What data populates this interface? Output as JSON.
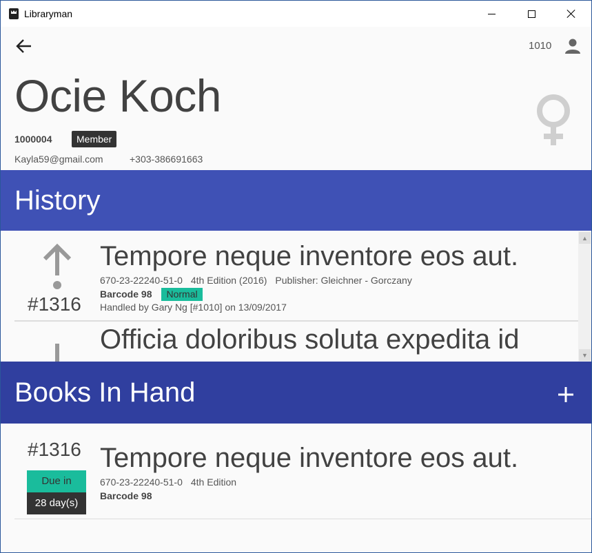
{
  "window": {
    "title": "Libraryman"
  },
  "appbar": {
    "user_id": "1010"
  },
  "member": {
    "name": "Ocie Koch",
    "id": "1000004",
    "badge": "Member",
    "email": "Kayla59@gmail.com",
    "phone": "+303-386691663",
    "gender_icon": "female-icon"
  },
  "history": {
    "title": "History",
    "items": [
      {
        "direction_icon": "arrow-up-icon",
        "number": "#1316",
        "book_title": "Tempore neque inventore eos aut.",
        "isbn": "670-23-22240-51-0",
        "edition": "4th Edition (2016)",
        "publisher": "Publisher: Gleichner - Gorczany",
        "barcode": "Barcode 98",
        "condition": "Normal",
        "handled_by": "Handled by Gary Ng [#1010] on 13/09/2017"
      },
      {
        "direction_icon": "arrow-down-icon",
        "book_title": "Officia doloribus soluta expedita id"
      }
    ]
  },
  "books_in_hand": {
    "title": "Books In Hand",
    "items": [
      {
        "number": "#1316",
        "due_label": "Due in",
        "due_value": "28 day(s)",
        "book_title": "Tempore neque inventore eos aut.",
        "isbn": "670-23-22240-51-0",
        "edition": "4th Edition",
        "barcode": "Barcode 98"
      }
    ]
  },
  "colors": {
    "history_header": "#3f51b5",
    "books_header": "#303f9f",
    "accent": "#1abc9c",
    "badge": "#333333"
  }
}
